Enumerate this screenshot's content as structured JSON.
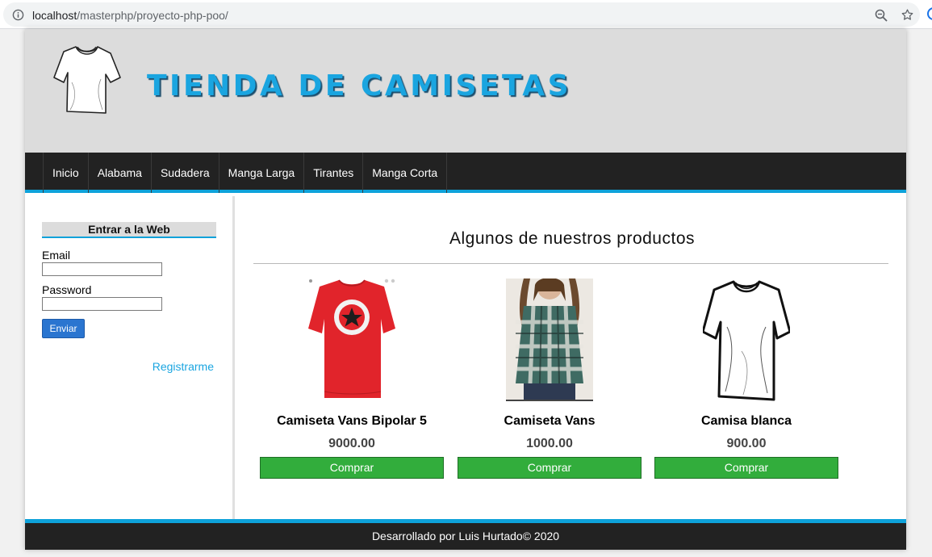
{
  "browser": {
    "url_host": "localhost",
    "url_path": "/masterphp/proyecto-php-poo/",
    "icons": [
      "info-icon",
      "zoom-icon",
      "bookmark-star-icon"
    ]
  },
  "header": {
    "logo_icon": "tshirt-outline-icon",
    "brand": "TIENDA DE CAMISETAS"
  },
  "nav": {
    "items": [
      {
        "label": "Inicio"
      },
      {
        "label": "Alabama"
      },
      {
        "label": "Sudadera"
      },
      {
        "label": "Manga Larga"
      },
      {
        "label": "Tirantes"
      },
      {
        "label": "Manga Corta"
      }
    ]
  },
  "sidebar": {
    "title": "Entrar a la Web",
    "email_label": "Email",
    "email_value": "",
    "password_label": "Password",
    "password_value": "",
    "submit_label": "Enviar",
    "register_link": "Registrarme"
  },
  "main": {
    "title": "Algunos de nuestros productos",
    "products": [
      {
        "name": "Camiseta Vans Bipolar 5",
        "price": "9000.00",
        "button": "Comprar",
        "image": "red-converse-tshirt-image"
      },
      {
        "name": "Camiseta Vans",
        "price": "1000.00",
        "button": "Comprar",
        "image": "plaid-flannel-shirt-image"
      },
      {
        "name": "Camisa blanca",
        "price": "900.00",
        "button": "Comprar",
        "image": "white-tshirt-image"
      }
    ]
  },
  "footer": {
    "text": "Desarrollado por Luis Hurtado© 2020"
  },
  "colors": {
    "accent": "#0ea2da",
    "brand_text": "#1aa5e0",
    "nav_bg": "#222222",
    "header_bg": "#dcdcdc",
    "buy_button": "#32ad3c",
    "submit_button": "#2a75d0"
  }
}
